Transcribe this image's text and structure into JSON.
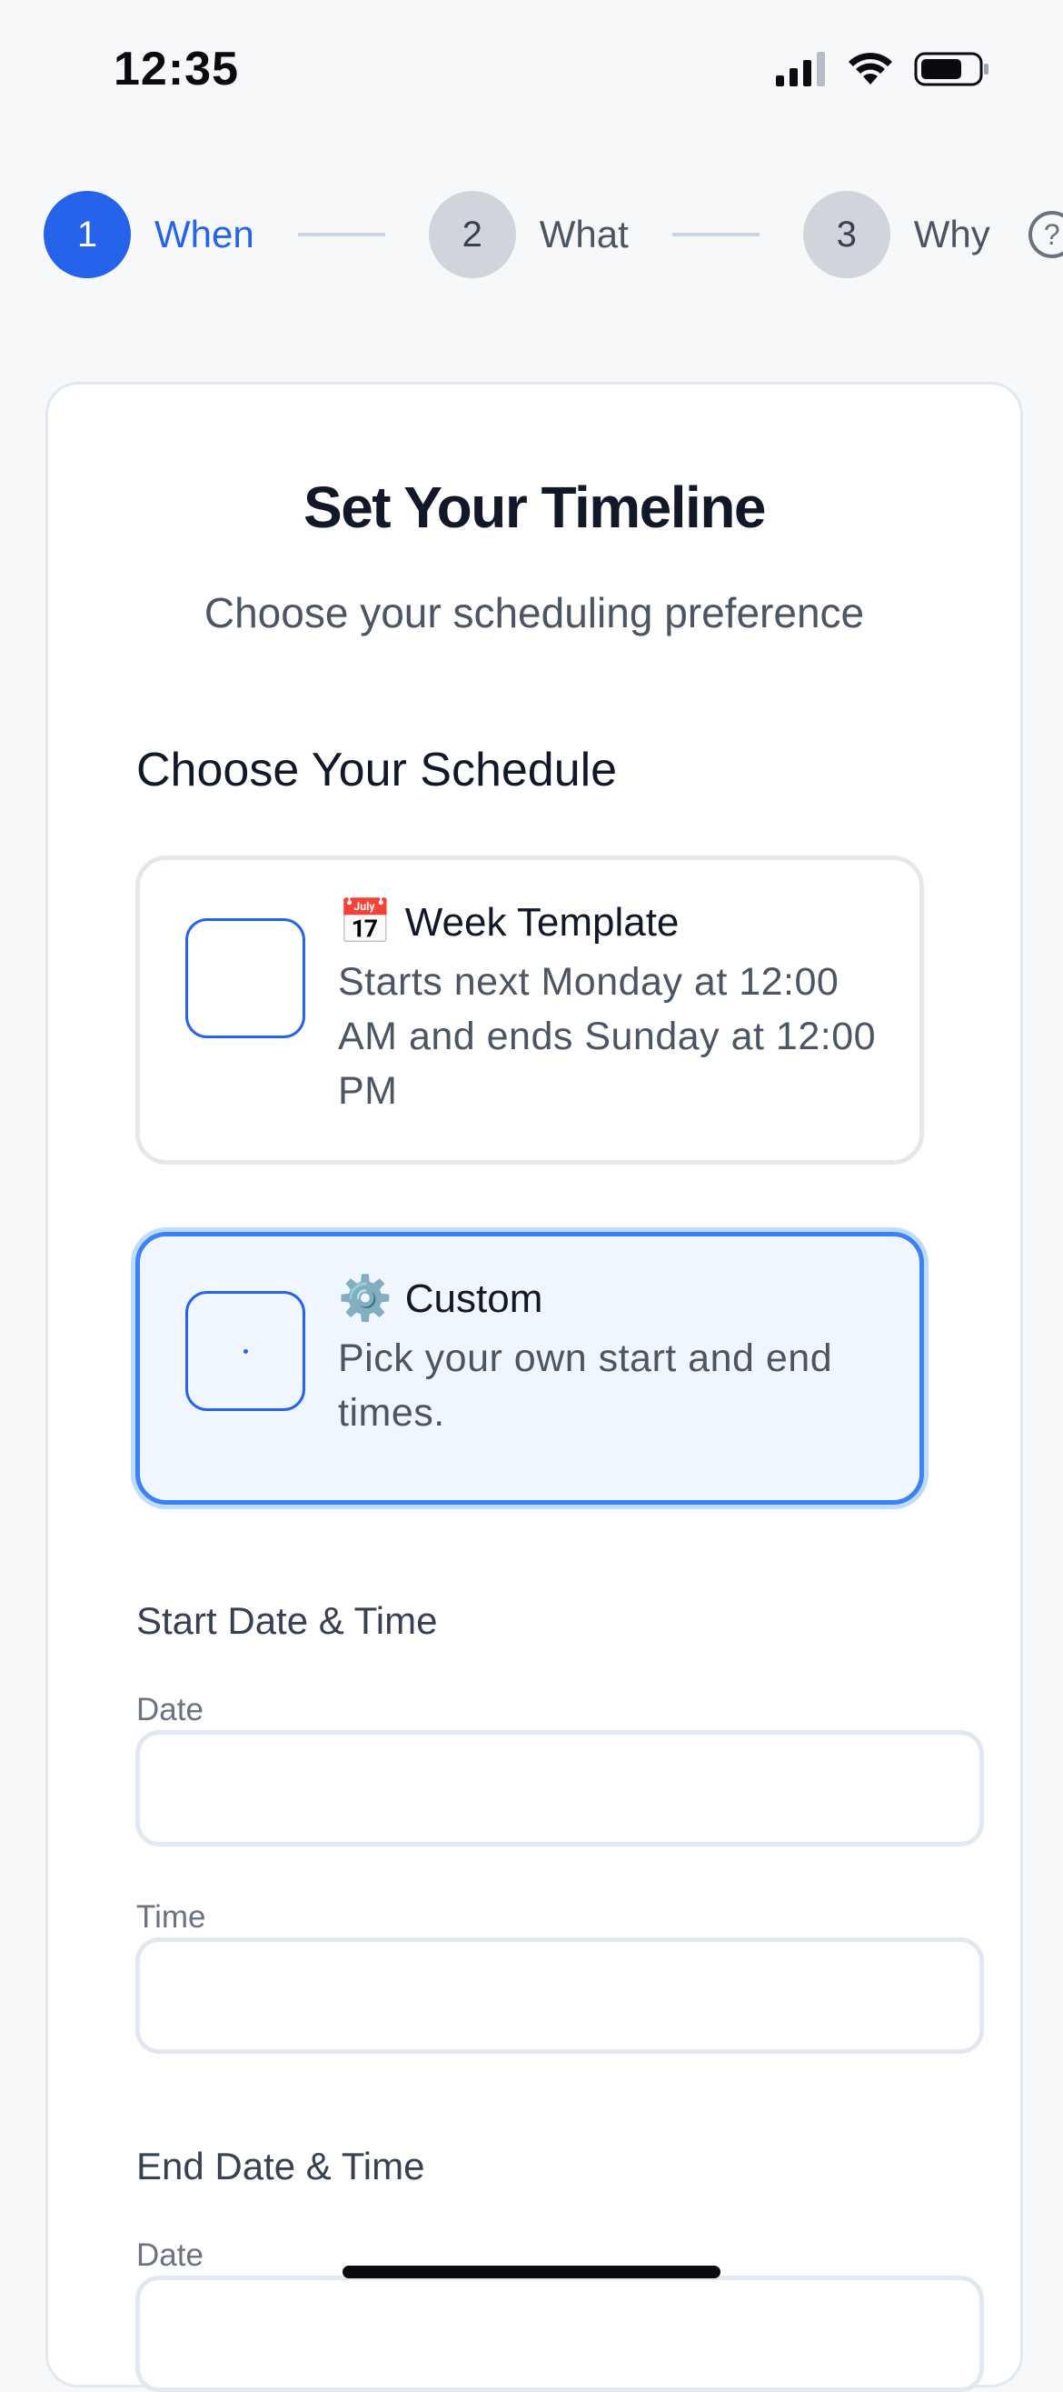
{
  "status_bar": {
    "time": "12:35"
  },
  "stepper": {
    "steps": [
      {
        "number": "1",
        "label": "When"
      },
      {
        "number": "2",
        "label": "What"
      },
      {
        "number": "3",
        "label": "Why"
      }
    ],
    "help_glyph": "?"
  },
  "card": {
    "title": "Set Your Timeline",
    "subtitle": "Choose your scheduling preference",
    "section_heading": "Choose Your Schedule",
    "options": [
      {
        "icon": "📅",
        "title": "Week Template",
        "description": "Starts next Monday at 12:00 AM and ends Sunday at 12:00 PM",
        "selected": false
      },
      {
        "icon": "⚙️",
        "title": "Custom",
        "description": "Pick your own start and end times.",
        "selected": true
      }
    ],
    "start": {
      "heading": "Start Date & Time",
      "date_label": "Date",
      "date_value": "",
      "time_label": "Time",
      "time_value": ""
    },
    "end": {
      "heading": "End Date & Time",
      "date_label": "Date",
      "date_value": ""
    }
  },
  "colors": {
    "accent": "#2563eb",
    "selected_bg": "#eff6ff",
    "inactive_step": "#d1d5db"
  }
}
